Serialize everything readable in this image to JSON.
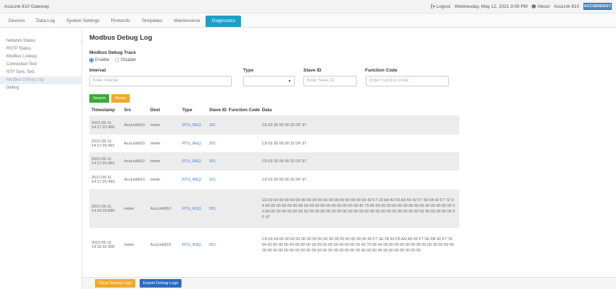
{
  "topbar": {
    "app_title": "AcuLink 810 Gateway",
    "logout": "Logout",
    "datetime": "Wednesday, May 12, 2021 3:09 PM",
    "about": "About",
    "device": "AcuLink 810",
    "brand_logo": "ACCUENERGY"
  },
  "tabs": [
    "Devices",
    "Data Log",
    "System Settings",
    "Protocols",
    "Templates",
    "Maintenance",
    "Diagnostics"
  ],
  "active_tab_index": 6,
  "sidebar": {
    "items": [
      "Network Status",
      "RSTP Status",
      "Modbus Lookup",
      "Connection Test",
      "NTP Sync Test",
      "Modbus Debug Log",
      "Debug"
    ],
    "active_index": 5
  },
  "page": {
    "title": "Modbus Debug Log",
    "trace_label": "Modbus Debug Trace",
    "enable": "Enable",
    "disable": "Disable"
  },
  "filters": {
    "interval_label": "Interval",
    "interval_placeholder": "Enter Interval",
    "type_label": "Type",
    "type_value": "",
    "slave_label": "Slave ID",
    "slave_placeholder": "Enter Slave ID",
    "function_label": "Function Code",
    "function_placeholder": "Enter Function Code"
  },
  "buttons": {
    "search": "Search",
    "reset": "Reset",
    "clear": "Clear Debug Logs",
    "export": "Export Debug Logs"
  },
  "table": {
    "headers": [
      "Timestamp",
      "Src",
      "Dest",
      "Type",
      "Slave ID",
      "Function Code",
      "Data"
    ],
    "rows": [
      {
        "date": "2021-05-11",
        "time": "14:17:20.466",
        "src": "AcuLink810",
        "dest": "meter",
        "type": "RTU_REQ",
        "slave": "201",
        "func": "",
        "data": "C9 03 20 00 00 32 DF 97"
      },
      {
        "date": "2021-05-11",
        "time": "14:17:20.491",
        "src": "AcuLink810",
        "dest": "meter",
        "type": "RTU_REQ",
        "slave": "201",
        "func": "",
        "data": "C9 03 20 00 00 32 DF 97"
      },
      {
        "date": "2021-05-11",
        "time": "14:17:20.463",
        "src": "AcuLink810",
        "dest": "meter",
        "type": "RTU_REQ",
        "slave": "201",
        "func": "",
        "data": "C9 03 20 00 00 32 DF 97"
      },
      {
        "date": "2021-05-11",
        "time": "14:17:25.463",
        "src": "AcuLink810",
        "dest": "meter",
        "type": "RTU_REQ",
        "slave": "201",
        "func": "",
        "data": "C9 03 20 00 00 32 DF 97"
      },
      {
        "date": "2021-05-11",
        "time": "14:16:33.890",
        "src": "meter",
        "dest": "AcuLink810",
        "type": "RTU_RSQ",
        "slave": "201",
        "func": "",
        "data": "C9 03 64 00 00 00 00 00 00 00 00 00 00 00 00 00 00 00 00 42 F7 23 A4 42 F6 A3 55 42 F7 55 04 42 F7 72 94 00 00 00 00 00 00 00 00 00 00 00 00 00 00 00 00 00 42 70 06 00 00 00 00 00 00 00 00 00 00 00 00 00 00 00 00 00 00 00 00 00 00 00 00 00 00 00 00 00 00 00 00 00 00 00 00 00 00 00 00 00 00 00 00 00 00 00 00 00 9F 07"
      },
      {
        "date": "2021-05-11",
        "time": "14:16:32.900",
        "src": "meter",
        "dest": "AcuLink810",
        "type": "RTU_RSQ",
        "slave": "201",
        "func": "",
        "data": "C9 03 64 00 00 00 00 00 00 00 00 00 00 00 00 00 00 00 00 42 F7 2E 28 42 F6 AD A9 42 F7 5E 6B 42 F7 7E 64 00 00 00 00 00 00 00 00 00 00 00 00 00 00 00 00 00 42 70 06 00 00 00 00 00 00 00 00 00 00 00 00 00 00 00 00 00 00 00 00 00 00 00 00 00 00 00 00 00 00 00 00 00 00 00 00 00 00 00 00 00 00 00"
      }
    ]
  }
}
